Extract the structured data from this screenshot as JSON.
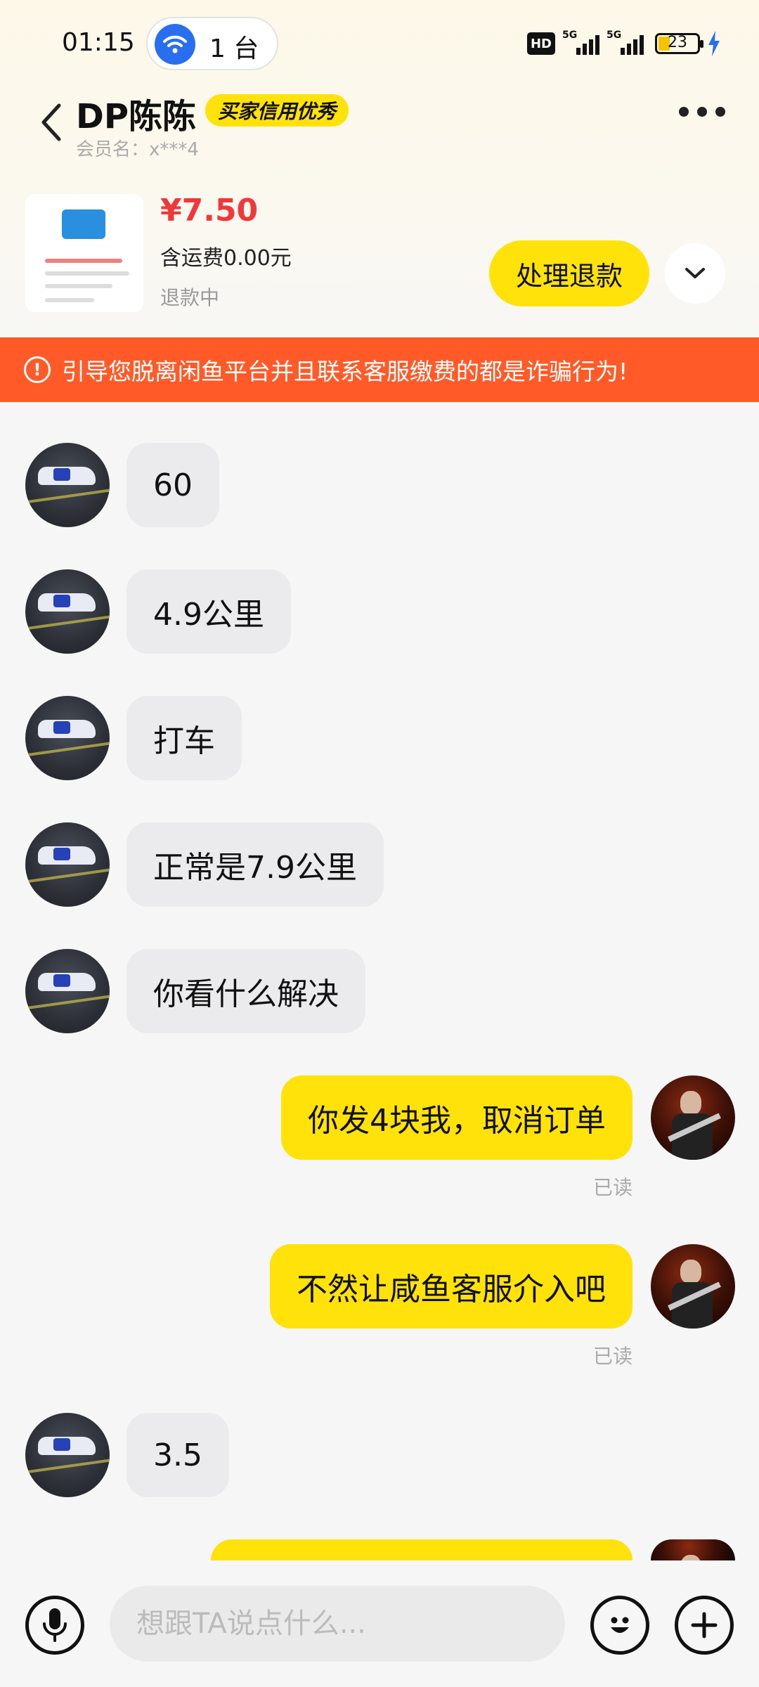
{
  "status_bar": {
    "time": "01:15",
    "hotspot_count": "1 台",
    "hd_label": "HD",
    "net1": "5G",
    "net2": "5G",
    "battery": "23"
  },
  "header": {
    "contact_name": "DP陈陈",
    "credit_badge": "买家信用优秀",
    "member_name": "会员名：x***4"
  },
  "product": {
    "price": "¥7.50",
    "shipping": "含运费0.00元",
    "status": "退款中",
    "refund_button": "处理退款"
  },
  "warning": {
    "icon": "!",
    "text": "引导您脱离闲鱼平台并且联系客服缴费的都是诈骗行为!"
  },
  "messages": [
    {
      "from": "other",
      "text": "60"
    },
    {
      "from": "other",
      "text": "4.9公里"
    },
    {
      "from": "other",
      "text": "打车"
    },
    {
      "from": "other",
      "text": "正常是7.9公里"
    },
    {
      "from": "other",
      "text": "你看什么解决"
    },
    {
      "from": "me",
      "text": "你发4块我，取消订单",
      "receipt": "已读"
    },
    {
      "from": "me",
      "text": "不然让咸鱼客服介入吧",
      "receipt": "已读"
    },
    {
      "from": "other",
      "text": "3.5"
    }
  ],
  "input": {
    "placeholder": "想跟TA说点什么..."
  },
  "colors": {
    "accent_yellow": "#ffe20a",
    "price_red": "#f0373a",
    "warning_orange": "#ff5a27"
  }
}
